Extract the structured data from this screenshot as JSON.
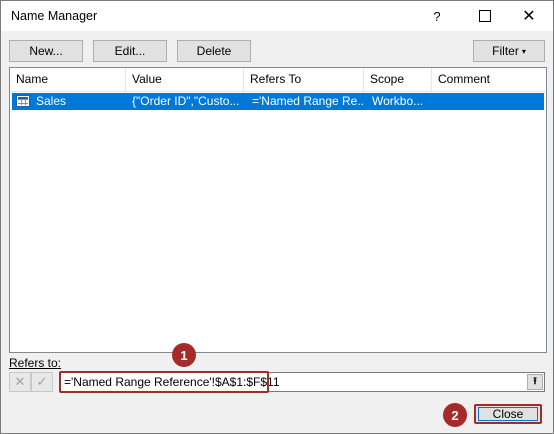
{
  "window": {
    "title": "Name Manager",
    "help_glyph": "?",
    "close_glyph": "✕"
  },
  "toolbar": {
    "new_label": "New...",
    "edit_label": "Edit...",
    "delete_label": "Delete",
    "filter_label": "Filter",
    "filter_caret": "▾"
  },
  "table": {
    "columns": [
      "Name",
      "Value",
      "Refers To",
      "Scope",
      "Comment"
    ],
    "rows": [
      {
        "name": "Sales",
        "value": "{\"Order ID\",\"Custo...",
        "refers_to": "='Named Range Re...",
        "scope": "Workbo...",
        "comment": "",
        "selected": true,
        "icon": "named-range-table-icon"
      }
    ]
  },
  "refers_to": {
    "label": "Refers to:",
    "value": "='Named Range Reference'!$A$1:$F$11",
    "cancel_glyph": "✕",
    "ok_glyph": "✓",
    "collapse_glyph": "⭱"
  },
  "annotations": {
    "badge_1": "1",
    "badge_2": "2",
    "color": "#a52a2a"
  },
  "footer": {
    "close_label": "Close"
  },
  "colors": {
    "selection": "#0078d7",
    "dialog_bg": "#f0f0f0"
  }
}
